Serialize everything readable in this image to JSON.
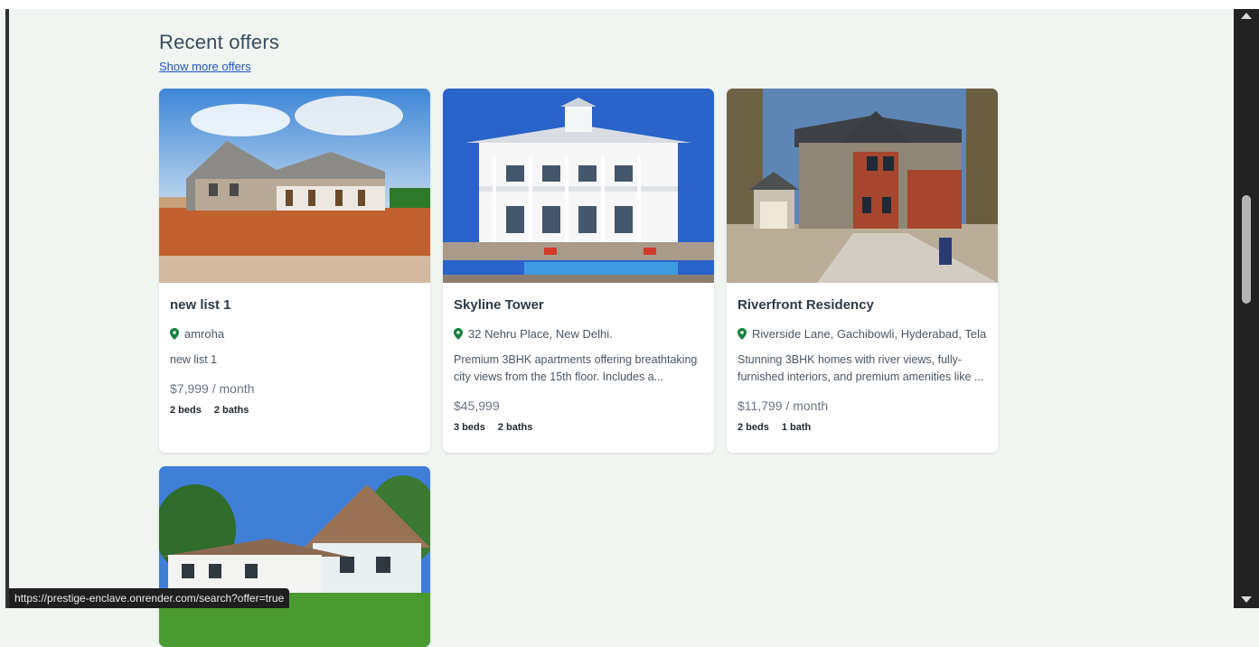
{
  "page": {
    "title": "Recent offers",
    "show_more_label": "Show more offers",
    "status_url": "https://prestige-enclave.onrender.com/search?offer=true"
  },
  "colors": {
    "accent": "#1f56c5",
    "pin": "#15803d",
    "background": "#f1f5f1"
  },
  "listings": [
    {
      "name": "new list 1",
      "location": "amroha",
      "description": "new list 1",
      "price": "$7,999 / month",
      "beds": "2 beds",
      "baths": "2 baths"
    },
    {
      "name": "Skyline Tower",
      "location": "32 Nehru Place, New Delhi.",
      "description": "Premium 3BHK apartments offering breathtaking city views from the 15th floor. Includes a...",
      "price": "$45,999",
      "beds": "3 beds",
      "baths": "2 baths"
    },
    {
      "name": "Riverfront Residency",
      "location": "Riverside Lane, Gachibowli, Hyderabad, Telan...",
      "description": "Stunning 3BHK homes with river views, fully-furnished interiors, and premium amenities like ...",
      "price": "$11,799 / month",
      "beds": "2 beds",
      "baths": "1 bath"
    }
  ],
  "icons": {
    "location": "map-pin-icon"
  }
}
